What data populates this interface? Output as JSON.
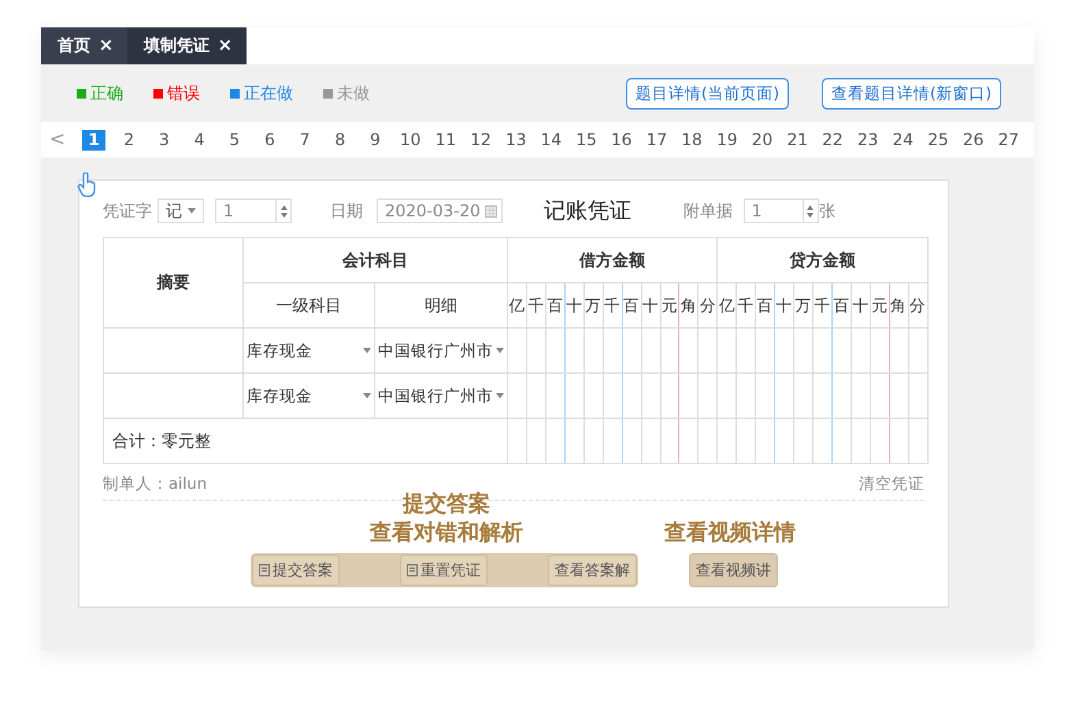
{
  "tabs": [
    {
      "label": "首页",
      "close": "×",
      "selected": false
    },
    {
      "label": "填制凭证",
      "close": "×",
      "selected": true
    }
  ],
  "legend": [
    {
      "label": "正确",
      "color": "#1aad19"
    },
    {
      "label": "错误",
      "color": "#ff0000"
    },
    {
      "label": "正在做",
      "color": "#1e88e5"
    },
    {
      "label": "未做",
      "color": "#999999"
    }
  ],
  "detail_buttons": [
    "题目详情(当前页面)",
    "查看题目详情(新窗口)"
  ],
  "pagination": {
    "prev": "<",
    "pages": [
      {
        "label": "1",
        "selected": true
      },
      {
        "label": "2",
        "selected": false
      },
      {
        "label": "3",
        "selected": false
      },
      {
        "label": "4",
        "selected": false
      },
      {
        "label": "5",
        "selected": false
      },
      {
        "label": "6",
        "selected": false
      },
      {
        "label": "7",
        "selected": false
      },
      {
        "label": "8",
        "selected": false
      },
      {
        "label": "9",
        "selected": false
      },
      {
        "label": "10",
        "selected": false
      },
      {
        "label": "11",
        "selected": false
      },
      {
        "label": "12",
        "selected": false
      },
      {
        "label": "13",
        "selected": false
      },
      {
        "label": "14",
        "selected": false
      },
      {
        "label": "15",
        "selected": false
      },
      {
        "label": "16",
        "selected": false
      },
      {
        "label": "17",
        "selected": false
      },
      {
        "label": "18",
        "selected": false
      },
      {
        "label": "19",
        "selected": false
      },
      {
        "label": "20",
        "selected": false
      },
      {
        "label": "21",
        "selected": false
      },
      {
        "label": "22",
        "selected": false
      },
      {
        "label": "23",
        "selected": false
      },
      {
        "label": "24",
        "selected": false
      },
      {
        "label": "25",
        "selected": false
      },
      {
        "label": "26",
        "selected": false
      },
      {
        "label": "27",
        "selected": false
      }
    ]
  },
  "voucher": {
    "word_label": "凭证字",
    "word_value": "记",
    "number": "1",
    "date_label": "日期",
    "date": "2020-03-20",
    "title": "记账凭证",
    "attach_label": "附单据",
    "attach": "1",
    "attach_unit": "张",
    "headers": {
      "summary": "摘要",
      "account": "会计科目",
      "level1": "一级科目",
      "detail": "明细",
      "debit": "借方金额",
      "credit": "贷方金额",
      "debit_digits": [
        "亿",
        "千",
        "百",
        "十",
        "万",
        "千",
        "百",
        "十",
        "元",
        "角",
        "分"
      ],
      "credit_digits": [
        "亿",
        "千",
        "百",
        "十",
        "万",
        "千",
        "百",
        "十",
        "元",
        "角",
        "分"
      ]
    },
    "rows": [
      {
        "account": "库存现金",
        "detail": "中国银行广州市"
      },
      {
        "account": "库存现金",
        "detail": "中国银行广州市"
      }
    ],
    "total": "合计：零元整",
    "maker": "制单人：ailun",
    "clear": "清空凭证"
  },
  "annotations": {
    "submit": "提交答案",
    "check": "查看对错和解析",
    "video": "查看视频详情"
  },
  "action_buttons": [
    {
      "label": "提交答案",
      "icon": true
    },
    {
      "label": "重置凭证",
      "icon": true
    },
    {
      "label": "查看答案解",
      "icon": false
    }
  ],
  "video_button": "查看视频讲"
}
